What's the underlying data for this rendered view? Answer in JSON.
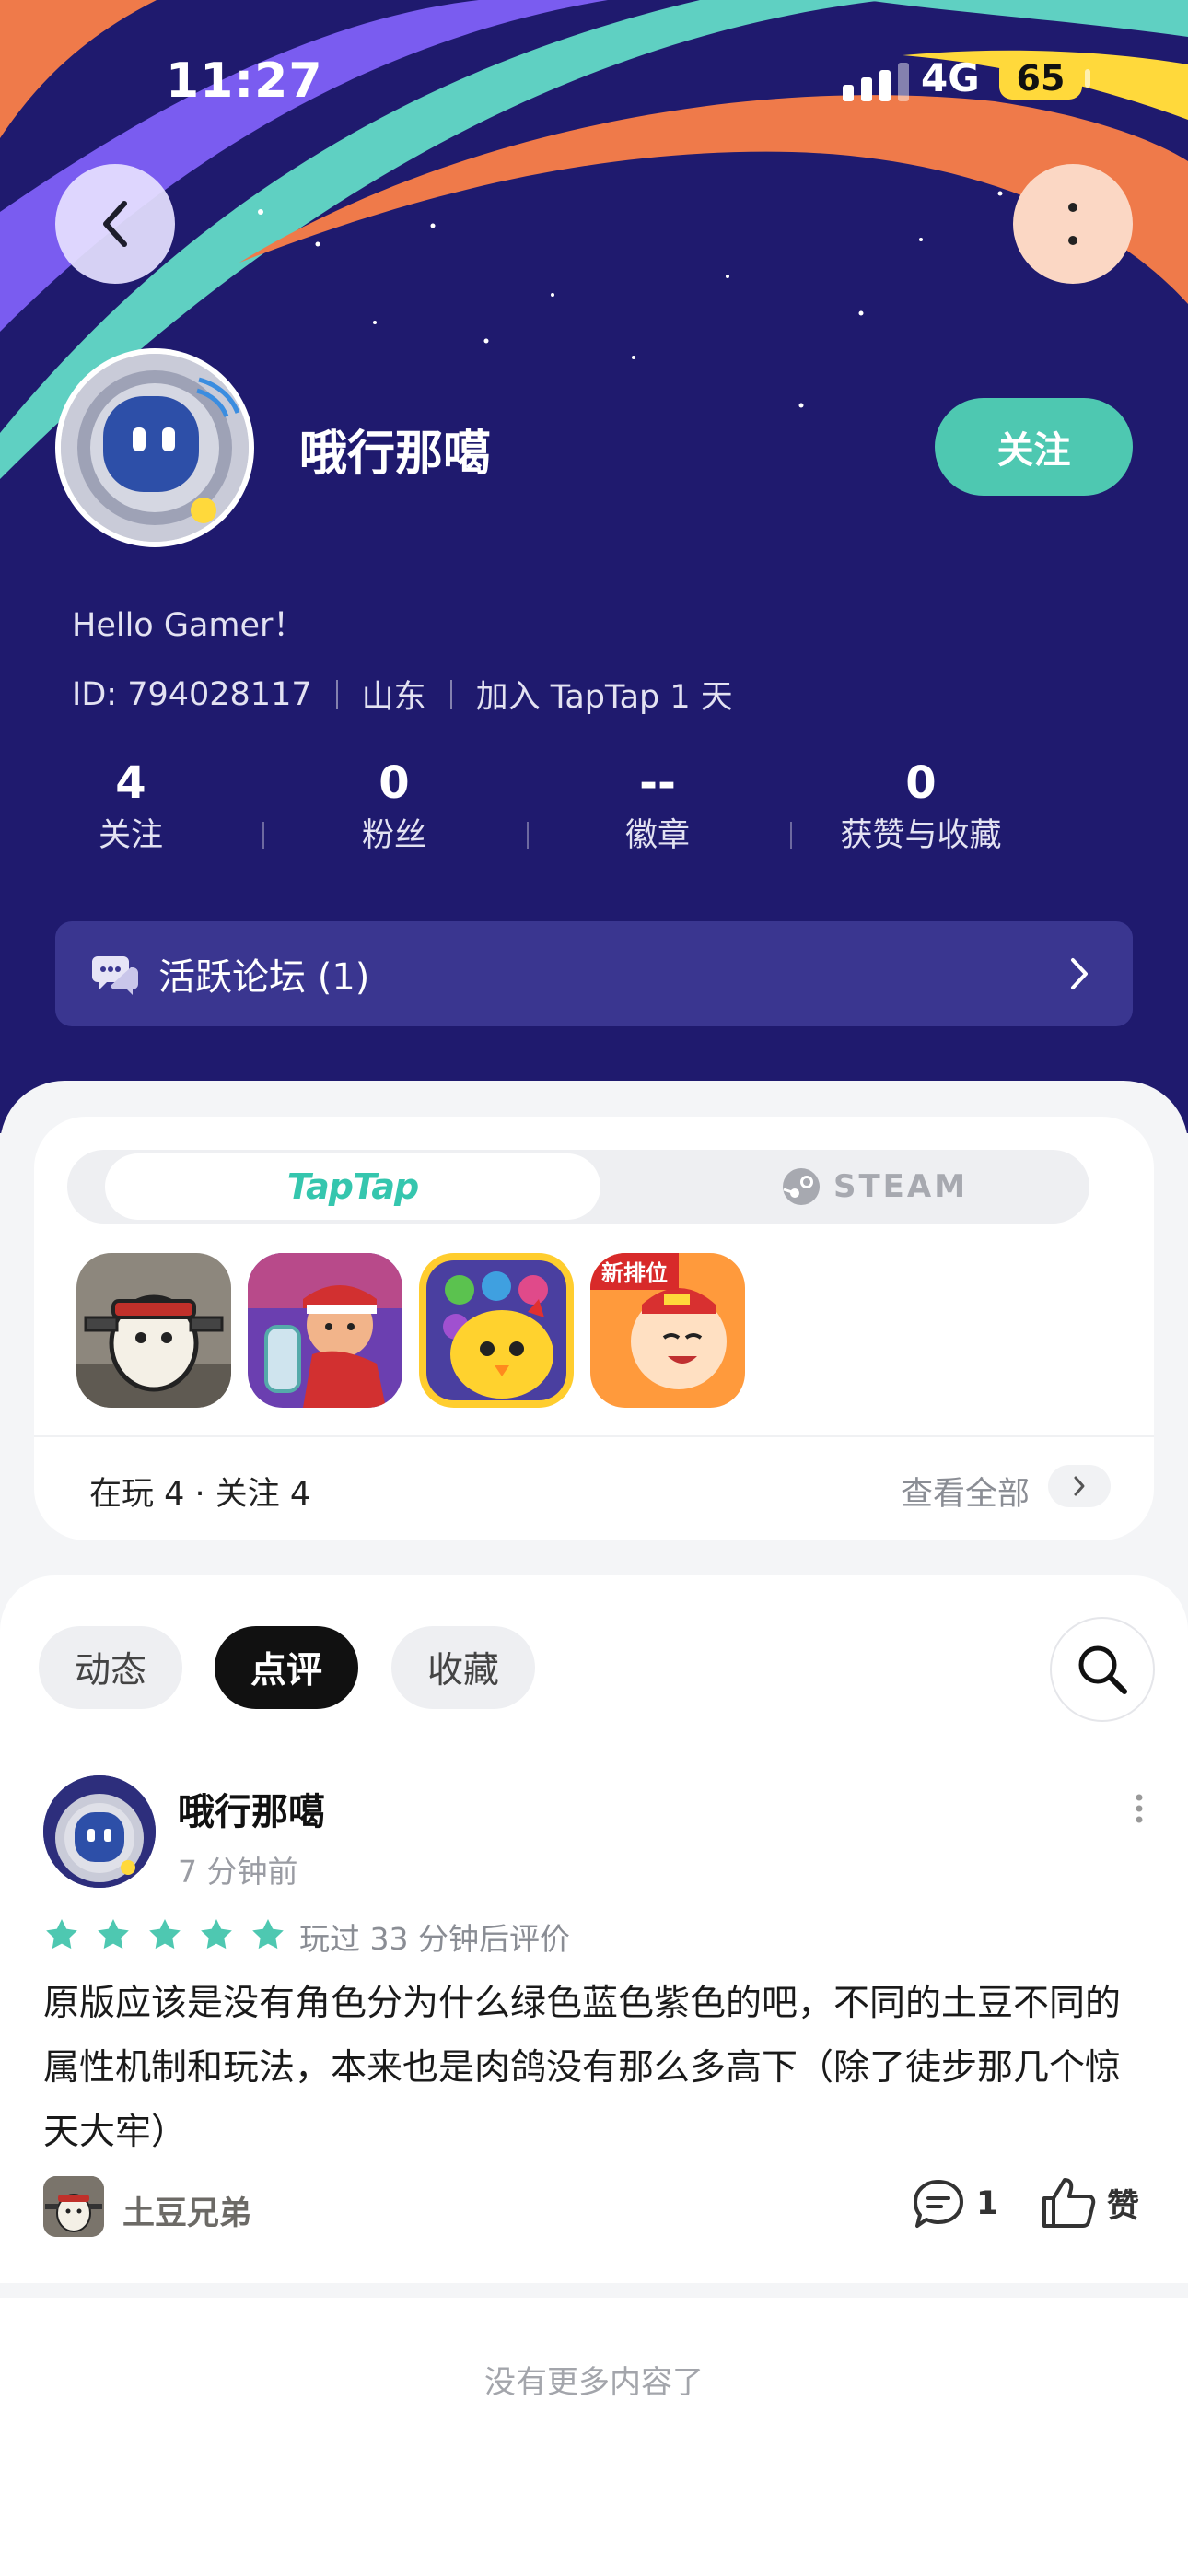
{
  "status_bar": {
    "time": "11:27",
    "network": "4G",
    "battery": "65"
  },
  "profile": {
    "username": "哦行那噶",
    "follow_label": "关注",
    "bio": "Hello Gamer！",
    "id_text": "ID: 794028117",
    "location": "山东",
    "joined": "加入 TapTap 1 天"
  },
  "stats": [
    {
      "value": "4",
      "label": "关注"
    },
    {
      "value": "0",
      "label": "粉丝"
    },
    {
      "value": "--",
      "label": "徽章"
    },
    {
      "value": "0",
      "label": "获赞与收藏"
    }
  ],
  "forum": {
    "label": "活跃论坛 (1)"
  },
  "games": {
    "tabs": {
      "taptap": "TapTap",
      "steam": "STEAM"
    },
    "icons": [
      "potato-brothers-icon",
      "subway-surfers-icon",
      "match-puzzle-icon",
      "fighting-landlord-icon"
    ],
    "icon_badge": "新排位",
    "summary": "在玩 4 · 关注 4",
    "view_all": "查看全部"
  },
  "feed": {
    "tabs": [
      {
        "label": "动态",
        "active": false
      },
      {
        "label": "点评",
        "active": true
      },
      {
        "label": "收藏",
        "active": false
      }
    ],
    "post": {
      "user": "哦行那噶",
      "time": "7 分钟前",
      "rating": 5,
      "played": "玩过 33 分钟后评价",
      "body": "原版应该是没有角色分为什么绿色蓝色紫色的吧，不同的土豆不同的属性机制和玩法，本来也是肉鸽没有那么多高下（除了徒步那几个惊天大牢）",
      "game": "土豆兄弟",
      "comments": "1",
      "like_label": "赞"
    },
    "end_text": "没有更多内容了"
  },
  "colors": {
    "hero_bg": "#1f1a6e",
    "accent_teal": "#4ec8b1",
    "star": "#4ec8b1"
  }
}
